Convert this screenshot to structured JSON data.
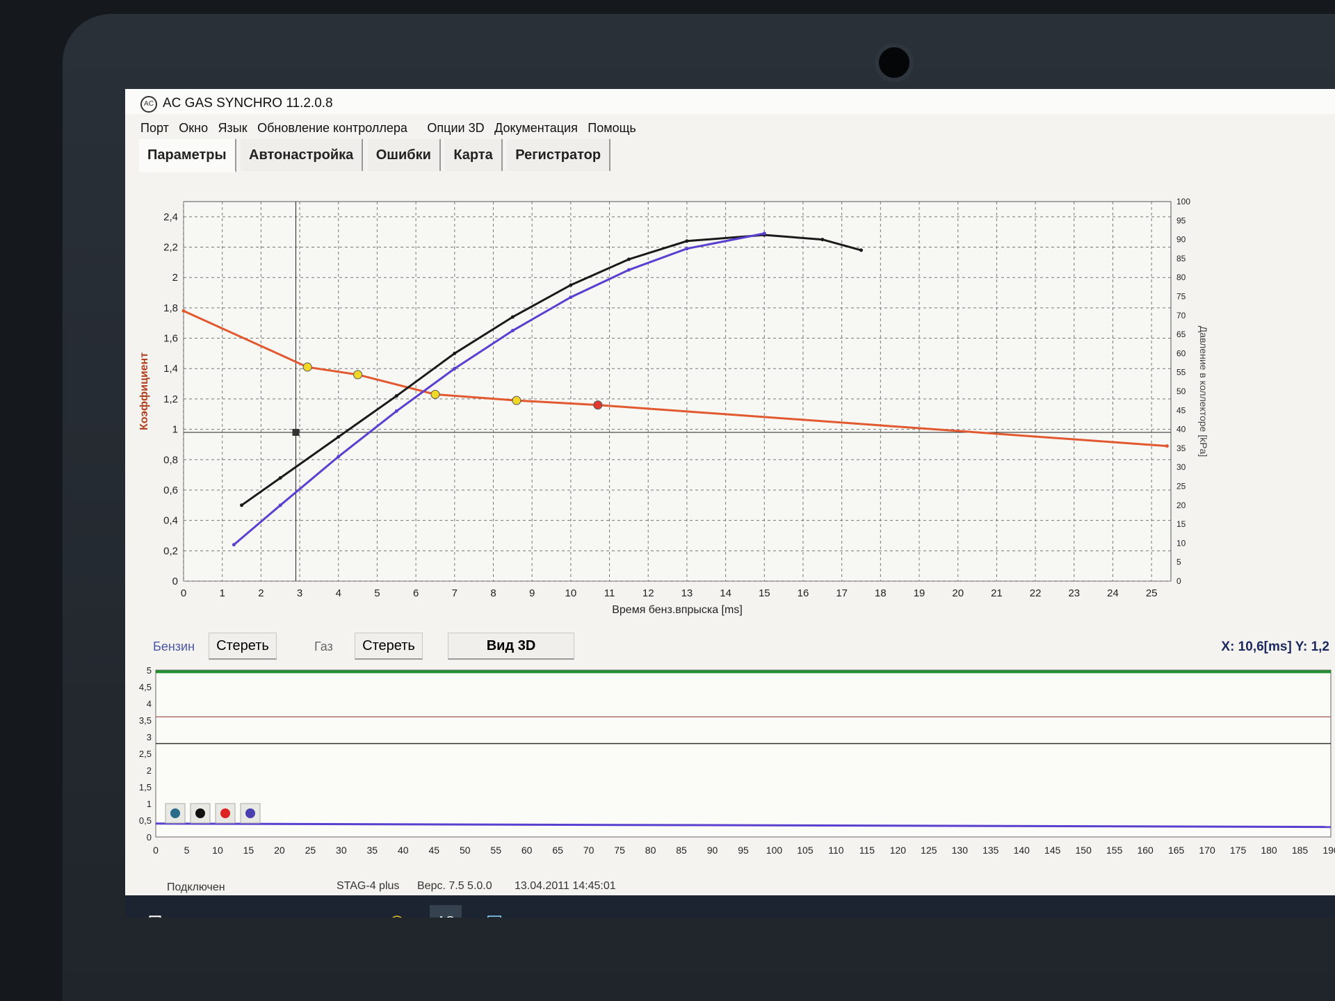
{
  "window": {
    "title": "AC GAS SYNCHRO  11.2.0.8"
  },
  "menu": [
    "Порт",
    "Окно",
    "Язык",
    "Обновление контроллера",
    "Опции 3D",
    "Документация",
    "Помощь"
  ],
  "tabs": [
    "Параметры",
    "Автонастройка",
    "Ошибки",
    "Карта",
    "Регистратор"
  ],
  "chart_data": [
    {
      "type": "scatter",
      "xlabel": "Время бенз.впрыска [ms]",
      "ylabel": "Коэффициент",
      "y2label": "Давление в коллекторе [kPa]",
      "xlim": [
        0,
        25.5
      ],
      "ylim": [
        0,
        2.5
      ],
      "y2lim": [
        0,
        100
      ],
      "xticks": [
        "0",
        "1",
        "2",
        "3",
        "4",
        "5",
        "6",
        "7",
        "8",
        "9",
        "10",
        "11",
        "12",
        "13",
        "14",
        "15",
        "16",
        "17",
        "18",
        "19",
        "20",
        "21",
        "22",
        "23",
        "24",
        "25"
      ],
      "yticks": [
        "0",
        "0,2",
        "0,4",
        "0,6",
        "0,8",
        "1",
        "1,2",
        "1,4",
        "1,6",
        "1,8",
        "2",
        "2,2",
        "2,4"
      ],
      "y2ticks": [
        "0",
        "5",
        "10",
        "15",
        "20",
        "25",
        "30",
        "35",
        "40",
        "45",
        "50",
        "55",
        "60",
        "65",
        "70",
        "75",
        "80",
        "85",
        "90",
        "95",
        "100"
      ],
      "grid": true,
      "series": [
        {
          "name": "",
          "color": "#e2582f",
          "x": [
            0,
            3.2,
            4.5,
            6.5,
            8.6,
            10.7,
            25.4
          ],
          "y": [
            1.78,
            1.41,
            1.36,
            1.23,
            1.19,
            1.16,
            0.89
          ]
        },
        {
          "name": "",
          "color": "#1a1a1a",
          "x": [
            1.5,
            2.5,
            4,
            5.5,
            7,
            8.5,
            10,
            11.5,
            13,
            15,
            16.5,
            17.5
          ],
          "y": [
            0.5,
            0.68,
            0.95,
            1.22,
            1.5,
            1.74,
            1.95,
            2.12,
            2.24,
            2.28,
            2.25,
            2.18
          ]
        },
        {
          "name": "",
          "color": "#5b3fd0",
          "x": [
            1.3,
            2.5,
            4,
            5.5,
            7,
            8.5,
            10,
            11.5,
            13,
            15
          ],
          "y": [
            0.24,
            0.5,
            0.82,
            1.12,
            1.4,
            1.65,
            1.87,
            2.05,
            2.19,
            2.29
          ]
        }
      ],
      "markers": [
        {
          "x": 3.2,
          "y": 1.41,
          "color": "#f1d726"
        },
        {
          "x": 4.5,
          "y": 1.36,
          "color": "#f1d726"
        },
        {
          "x": 6.5,
          "y": 1.23,
          "color": "#f1d726"
        },
        {
          "x": 8.6,
          "y": 1.19,
          "color": "#f1d726"
        },
        {
          "x": 10.7,
          "y": 1.16,
          "color": "#e03a2f"
        }
      ],
      "cursor": {
        "x": 2.9,
        "y": 0.98
      }
    },
    {
      "type": "line",
      "xlim": [
        0,
        190
      ],
      "ylim": [
        0,
        5
      ],
      "xticks": [
        "0",
        "5",
        "10",
        "15",
        "20",
        "25",
        "30",
        "35",
        "40",
        "45",
        "50",
        "55",
        "60",
        "65",
        "70",
        "75",
        "80",
        "85",
        "90",
        "95",
        "100",
        "105",
        "110",
        "115",
        "120",
        "125",
        "130",
        "135",
        "140",
        "145",
        "150",
        "155",
        "160",
        "165",
        "170",
        "175",
        "180",
        "185",
        "190"
      ],
      "yticks": [
        "0",
        "0,5",
        "1",
        "1,5",
        "2",
        "2,5",
        "3",
        "3,5",
        "4",
        "4,5",
        "5"
      ],
      "series": [
        {
          "name": "",
          "color": "#1f8f2f",
          "values": [
            4.95
          ]
        },
        {
          "name": "",
          "color": "#b07070",
          "values": [
            3.6
          ]
        },
        {
          "name": "",
          "color": "#333333",
          "values": [
            2.8
          ]
        }
      ]
    }
  ],
  "controls": {
    "petrol_label": "Бензин",
    "petrol_clear": "Стереть",
    "gas_label": "Газ",
    "gas_clear": "Стереть",
    "view3d": "Вид 3D",
    "coords": "X: 10,6[ms]  Y: 1,2"
  },
  "status": {
    "connection": "Подключен",
    "device": "STAG-4 plus",
    "version": "Верс. 7.5  5.0.0",
    "datetime": "13.04.2011  14:45:01"
  },
  "taskbar": [
    "windows-icon",
    "search-icon",
    "task-view-icon",
    "edge-icon",
    "explorer-icon",
    "chrome-icon",
    "ac-icon",
    "app-icon"
  ]
}
